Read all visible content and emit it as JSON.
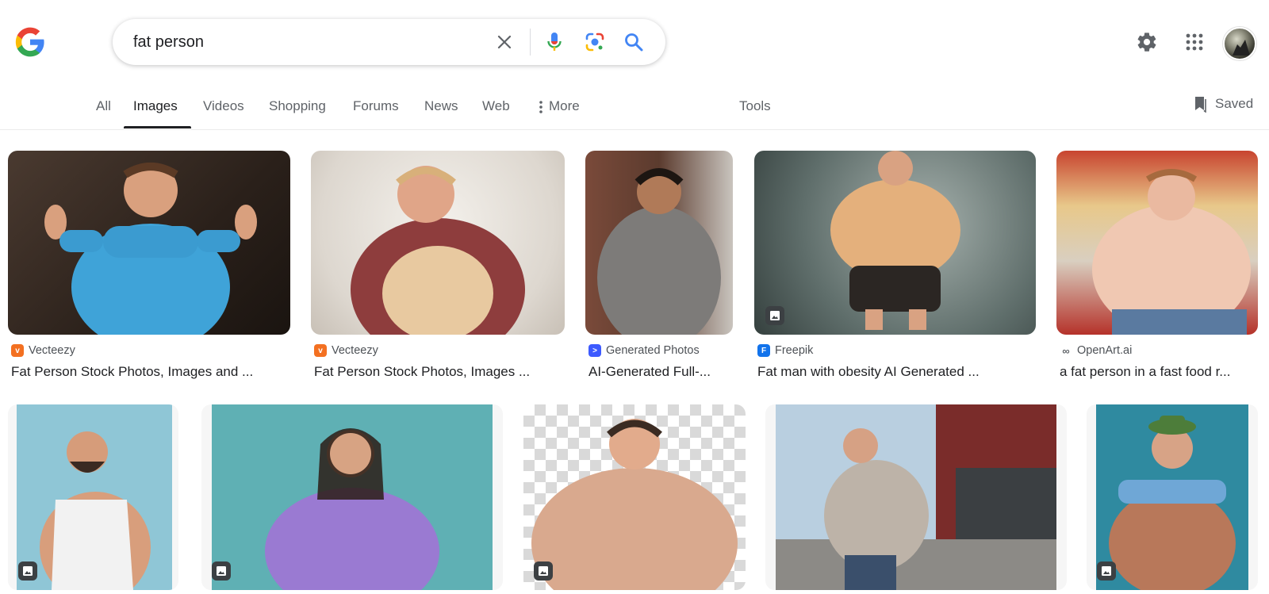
{
  "search": {
    "query": "fat person"
  },
  "tabs": [
    {
      "label": "All"
    },
    {
      "label": "Images"
    },
    {
      "label": "Videos"
    },
    {
      "label": "Shopping"
    },
    {
      "label": "Forums"
    },
    {
      "label": "News"
    },
    {
      "label": "Web"
    },
    {
      "label": "More"
    },
    {
      "label": "Tools"
    }
  ],
  "saved_label": "Saved",
  "icons": {
    "logo": "google-logo",
    "clear": "close-icon",
    "voice": "mic-icon",
    "lens": "camera-lens-icon",
    "search": "search-icon",
    "settings": "gear-icon",
    "apps": "apps-grid-icon",
    "saved": "bookmark-icon"
  },
  "colors": {
    "blue": "#4285f4",
    "red": "#ea4335",
    "yellow": "#fbbc05",
    "green": "#34a853",
    "vecteezy": "#f37021",
    "generated_photos": "#3d5afe",
    "freepik": "#1273eb"
  },
  "results_row1": [
    {
      "source": "Vecteezy",
      "title": "Fat Person Stock Photos, Images and ...",
      "has_badge": false
    },
    {
      "source": "Vecteezy",
      "title": "Fat Person Stock Photos, Images ...",
      "has_badge": false
    },
    {
      "source": "Generated Photos",
      "title": "AI-Generated Full-...",
      "has_badge": false
    },
    {
      "source": "Freepik",
      "title": "Fat man with obesity AI Generated ...",
      "has_badge": true
    },
    {
      "source": "OpenArt.ai",
      "title": "a fat person in a fast food r...",
      "has_badge": false
    }
  ],
  "results_row2": [
    {
      "has_badge": true
    },
    {
      "has_badge": true
    },
    {
      "has_badge": true
    },
    {
      "has_badge": false
    },
    {
      "has_badge": true
    }
  ]
}
